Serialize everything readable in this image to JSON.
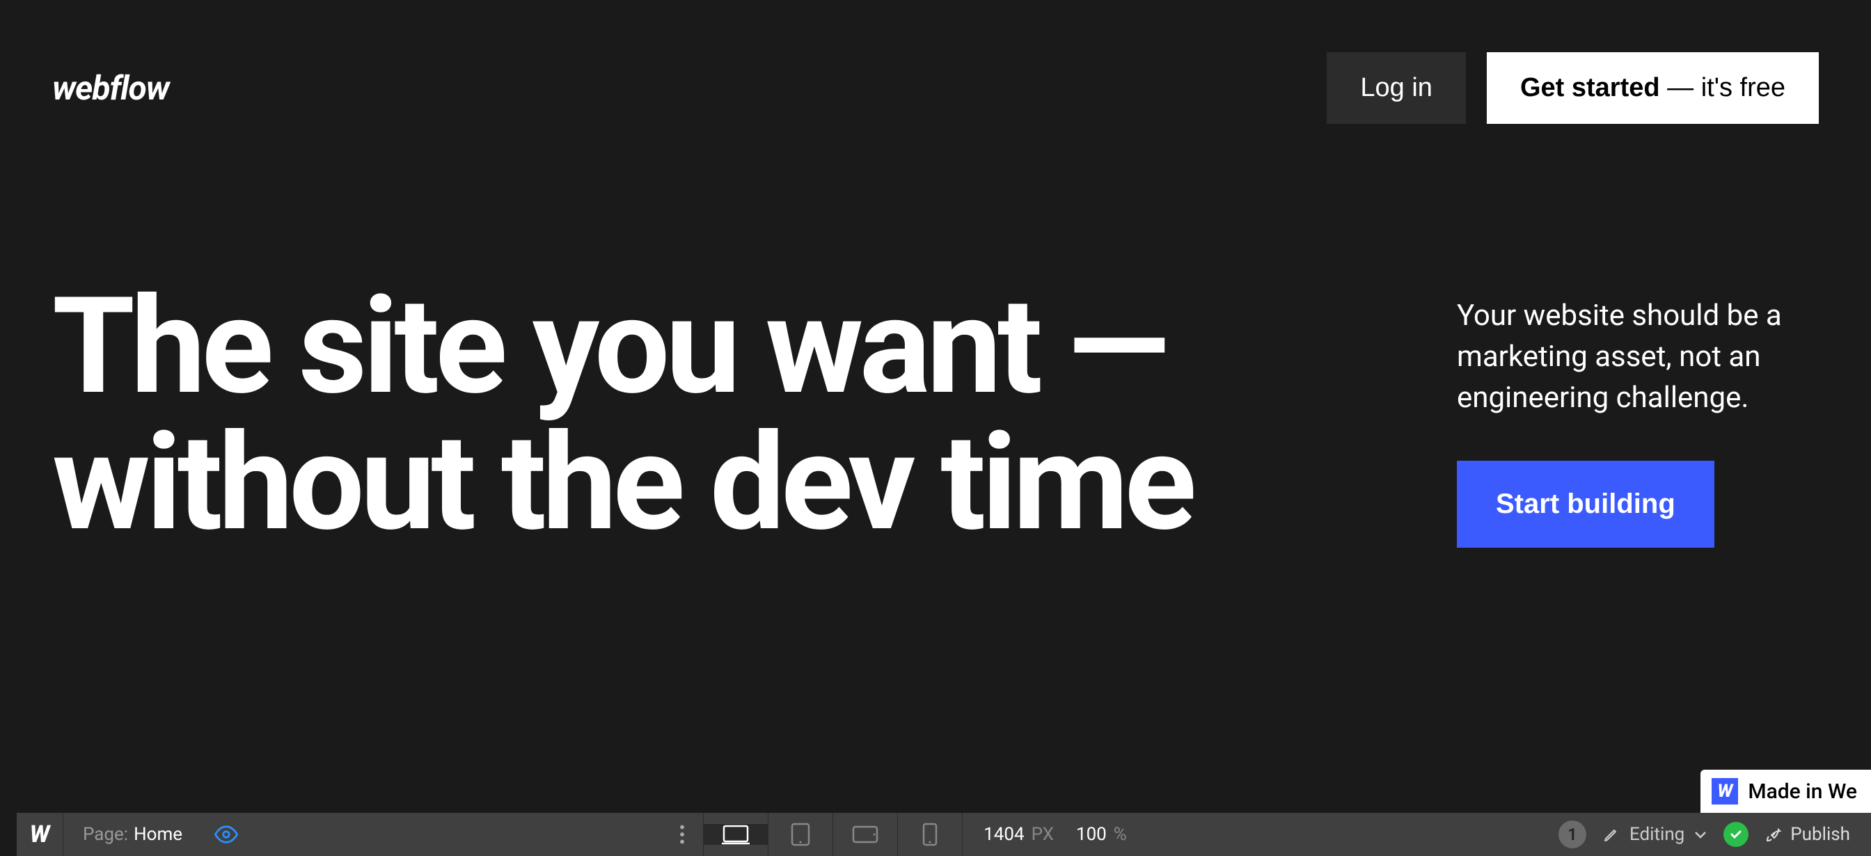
{
  "header": {
    "logo_text": "webflow",
    "login_label": "Log in",
    "getstarted_bold": "Get started",
    "getstarted_light": " — it's free"
  },
  "hero": {
    "title": "The site you want — without the dev time",
    "subtitle": "Your website should be a marketing asset, not an engineering challenge.",
    "cta_label": "Start building"
  },
  "bottom_bar": {
    "page_label": "Page:",
    "page_value": "Home",
    "width_value": "1404",
    "width_unit": "PX",
    "zoom_value": "100",
    "zoom_unit": "%",
    "badge_count": "1",
    "editing_label": "Editing",
    "publish_label": "Publish"
  },
  "badge": {
    "label": "Made in We"
  }
}
